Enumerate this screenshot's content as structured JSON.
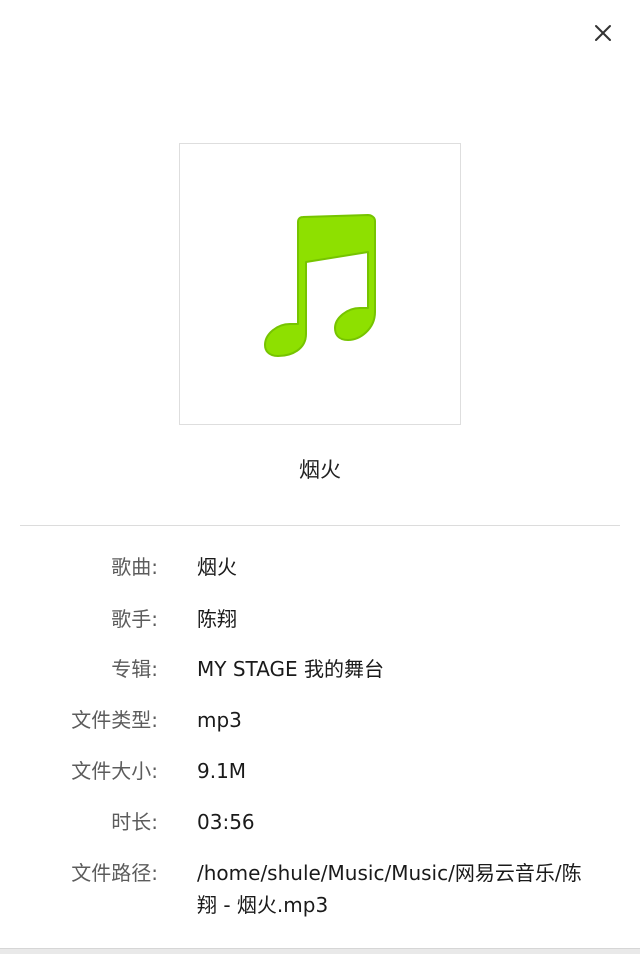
{
  "dialog": {
    "close_icon": "close-icon",
    "cover_icon": "music-note-icon",
    "cover_color": "#8ee000",
    "title": "烟火"
  },
  "info": [
    {
      "label": "歌曲:",
      "value": "烟火"
    },
    {
      "label": "歌手:",
      "value": "陈翔"
    },
    {
      "label": "专辑:",
      "value": "MY STAGE 我的舞台"
    },
    {
      "label": "文件类型:",
      "value": "mp3"
    },
    {
      "label": "文件大小:",
      "value": "9.1M"
    },
    {
      "label": "时长:",
      "value": "03:56"
    },
    {
      "label": "文件路径:",
      "value": "/home/shule/Music/Music/网易云音乐/陈翔 - 烟火.mp3"
    }
  ]
}
